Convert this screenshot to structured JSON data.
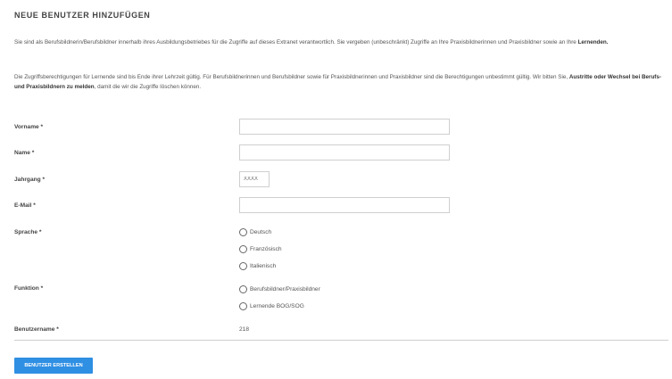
{
  "heading": "NEUE BENUTZER HINZUFÜGEN",
  "intro": {
    "p1_text": "Sie sind als Berufsbildnerin/Berufsbildner innerhalb ihres Ausbildungsbetriebes für die Zugriffe auf dieses Extranet verantwortlich. Sie vergeben (unbeschränkt) Zugriffe an Ihre Praxisbildnerinnen und Praxisbildner sowie an Ihre ",
    "p1_bold": "Lernenden.",
    "p2_text": "Die Zugriffsberechtigungen für Lernende sind bis Ende ihrer Lehrzeit gültig. Für Berufsbildnerinnen und Berufsbildner sowie für Praxisbildnerinnen und Praxisbildner sind die Berechtigungen unbestimmt gültig. Wir bitten Sie, ",
    "p2_bold": "Austritte oder Wechsel bei Berufs- und Praxisbildnern zu melden",
    "p2_end": ", damit die wir die Zugriffe löschen können."
  },
  "form": {
    "vorname_label": "Vorname *",
    "vorname_value": "",
    "name_label": "Name *",
    "name_value": "",
    "jahrgang_label": "Jahrgang *",
    "jahrgang_placeholder": "XXXX",
    "email_label": "E-Mail *",
    "email_value": "",
    "sprache_label": "Sprache *",
    "sprache_options": [
      "Deutsch",
      "Französisch",
      "Italienisch"
    ],
    "funktion_label": "Funktion *",
    "funktion_options": [
      "Berufsbildner/Praxisbildner",
      "Lernende BOG/SOG"
    ],
    "benutzername_label": "Benutzername *",
    "benutzername_value": "218",
    "submit_label": "BENUTZER ERSTELLEN"
  },
  "colors": {
    "button_bg": "#2f8fe3",
    "border": "#cfcfcf"
  }
}
